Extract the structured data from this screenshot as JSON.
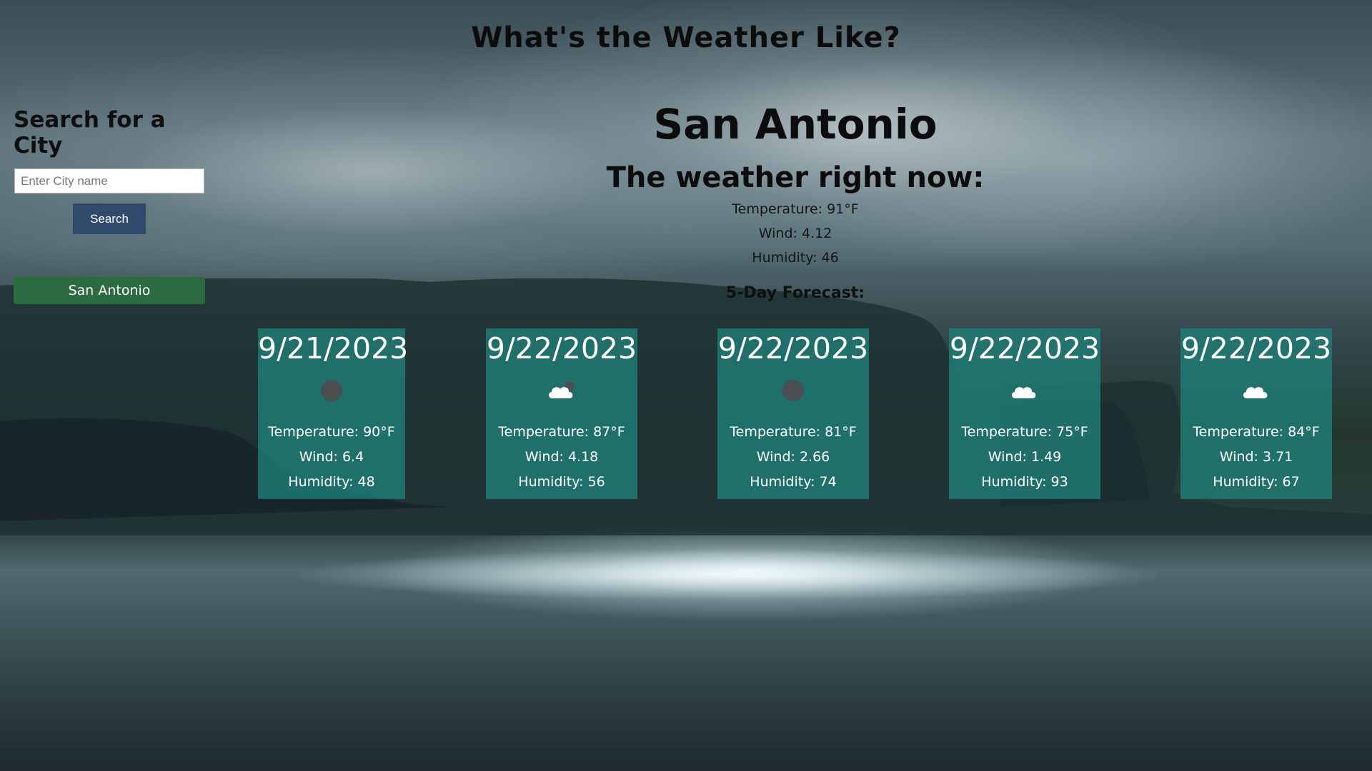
{
  "page": {
    "title": "What's the Weather Like?"
  },
  "sidebar": {
    "heading": "Search for a City",
    "search_placeholder": "Enter City name",
    "search_value": "",
    "search_button": "Search",
    "history": [
      "San Antonio"
    ]
  },
  "current": {
    "city": "San Antonio",
    "heading": "The weather right now:",
    "temperature": "Temperature: 91°F",
    "wind": "Wind: 4.12",
    "humidity": "Humidity: 46"
  },
  "forecast": {
    "heading": "5-Day Forecast:",
    "days": [
      {
        "date": "9/21/2023",
        "icon": "dark-moon-icon",
        "temperature": "Temperature: 90°F",
        "wind": "Wind: 6.4",
        "humidity": "Humidity: 48"
      },
      {
        "date": "9/22/2023",
        "icon": "cloud-icon",
        "temperature": "Temperature: 87°F",
        "wind": "Wind: 4.18",
        "humidity": "Humidity: 56"
      },
      {
        "date": "9/22/2023",
        "icon": "dark-moon-icon",
        "temperature": "Temperature: 81°F",
        "wind": "Wind: 2.66",
        "humidity": "Humidity: 74"
      },
      {
        "date": "9/22/2023",
        "icon": "cloud-icon",
        "temperature": "Temperature: 75°F",
        "wind": "Wind: 1.49",
        "humidity": "Humidity: 93"
      },
      {
        "date": "9/22/2023",
        "icon": "cloud-icon",
        "temperature": "Temperature: 84°F",
        "wind": "Wind: 3.71",
        "humidity": "Humidity: 67"
      }
    ]
  },
  "colors": {
    "search_button": "#2f4a6a",
    "history_button": "#2c6a3f",
    "forecast_card": "#207c76"
  }
}
